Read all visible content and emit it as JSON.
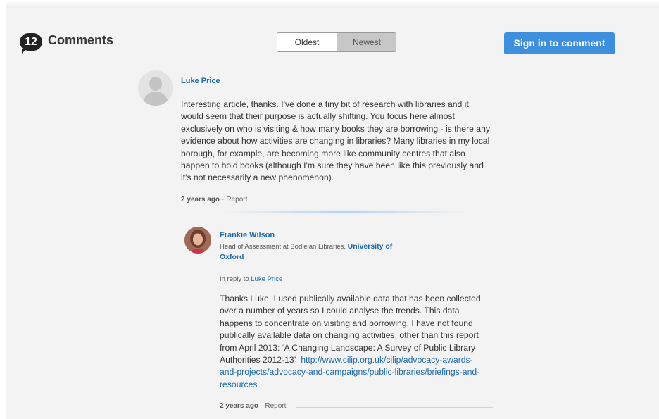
{
  "header": {
    "comment_count": "12",
    "title": "Comments",
    "sort_tabs": [
      "Oldest",
      "Newest"
    ],
    "active_sort": "Oldest",
    "sign_in_label": "Sign in to comment"
  },
  "comments": [
    {
      "author": "Luke Price",
      "lines": [
        "Interesting article, thanks. I've done a tiny bit of research with libraries and it",
        "would seem that their purpose is actually shifting. You focus here almost",
        "exclusively on who is visiting & how many books they are borrowing - is there any",
        "evidence about how activities are changing in libraries? Many libraries in my local",
        "borough, for example, are becoming more like community centres that also",
        "happen to hold books (although I'm sure they have been like this previously and",
        "it's not necessarily a new phenomenon)."
      ],
      "time_ago": "2 years ago",
      "report_label": "Report"
    },
    {
      "author": "Frankie Wilson",
      "role": "Head of Assessment at Bodleian Libraries,",
      "org_line1": "University of",
      "org_line2": "Oxford",
      "reply_prefix": "In reply to",
      "reply_to": "Luke Price",
      "lines": [
        "Thanks Luke. I used publically available data that has been collected",
        "over a number of years so I could analyse the trends. This data",
        "happens to concentrate on visiting and borrowing. I have not found",
        "publically available data on changing activities, other than this report",
        "from April 2013: ‘A Changing Landscape: A Survey of Public Library"
      ],
      "line6_text": "Authorities 2012-13’",
      "link_parts": [
        "http://www.cilip.org.uk/cilip/advocacy-awards-",
        "and-projects/advocacy-and-campaigns/public-libraries/briefings-and-",
        "resources"
      ],
      "time_ago": "2 years ago",
      "report_label": "Report"
    }
  ],
  "colors": {
    "link": "#1f6aa8",
    "button": "#3e8fdd",
    "background": "#f3f3f3"
  }
}
